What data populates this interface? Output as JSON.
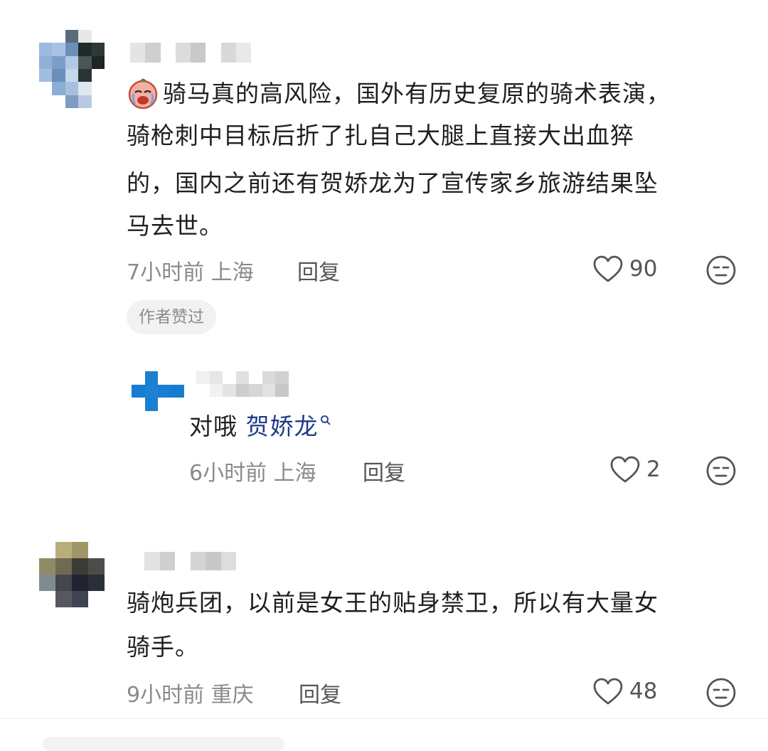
{
  "comments": [
    {
      "text": "骑马真的高风险，国外有历史复原的骑术表演，骑枪刺中目标后折了扎自己大腿上直接大出血猝的，国内之前还有贺娇龙为了宣传家乡旅游结果坠马去世。",
      "lines": [
        "骑马真的高风险，国外有历史复原的骑术表演，",
        "骑枪刺中目标后折了扎自己大腿上直接大出血猝",
        "的，国内之前还有贺娇龙为了宣传家乡旅游结果坠",
        "马去世。"
      ],
      "time": "7小时前",
      "location": "上海",
      "reply_label": "回复",
      "likes": "90",
      "badge": "作者赞过"
    },
    {
      "text_prefix": "对哦",
      "link_text": "贺娇龙",
      "time": "6小时前",
      "location": "上海",
      "reply_label": "回复",
      "likes": "2"
    },
    {
      "lines": [
        "骑炮兵团，以前是女王的贴身禁卫，所以有大量女",
        "骑手。"
      ],
      "time": "9小时前",
      "location": "重庆",
      "reply_label": "回复",
      "likes": "48"
    }
  ],
  "colors": {
    "link": "#1e3a8a",
    "meta": "#8a8a8a",
    "badge_bg": "#f2f2f2",
    "emoji_face": "#f4a89a"
  },
  "icons": [
    "heart-outline-icon",
    "dislike-face-icon",
    "search-icon",
    "crying-face-emoji"
  ]
}
